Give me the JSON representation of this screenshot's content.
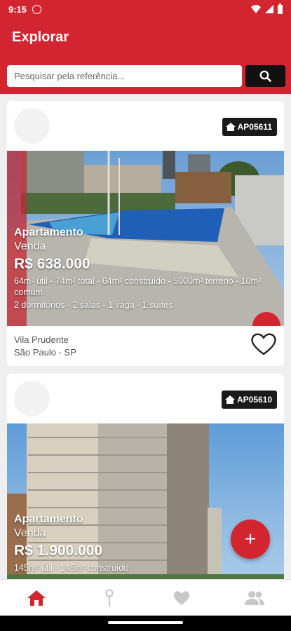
{
  "status": {
    "time": "9:15"
  },
  "header": {
    "title": "Explorar"
  },
  "search": {
    "placeholder": "Pesquisar pela referência..."
  },
  "listings": [
    {
      "ref": "AP05611",
      "type": "Apartamento",
      "deal": "Venda",
      "price": "R$ 638.000",
      "details": "64m² útil - 74m² total - 64m² construído - 5000m² terreno - 10m² comum",
      "rooms": "2 dormitórios - 2 salas - 1 vaga - 1 suítes",
      "neighborhood": "Vila Prudente",
      "city": "São Paulo - SP"
    },
    {
      "ref": "AP05610",
      "type": "Apartamento",
      "deal": "Venda",
      "price": "R$ 1.900.000",
      "details": "145m² útil - 145m² construído"
    }
  ],
  "colors": {
    "accent": "#d32530",
    "dark": "#1a1a1a"
  },
  "nav": {
    "items": [
      "home-icon",
      "map-pin-icon",
      "heart-icon",
      "people-icon"
    ]
  }
}
